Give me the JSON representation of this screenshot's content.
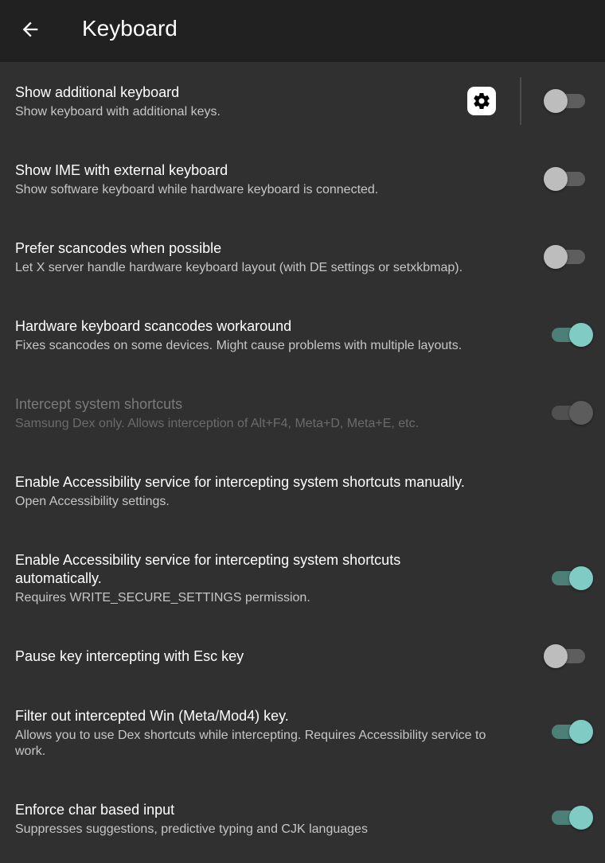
{
  "toolbar": {
    "title": "Keyboard",
    "back_icon": "arrow-back-icon"
  },
  "prefs": [
    {
      "title": "Show additional keyboard",
      "summary": "Show keyboard with additional keys.",
      "state": "off",
      "has_settings_button": true,
      "settings_icon": "gear-icon"
    },
    {
      "title": "Show IME with external keyboard",
      "summary": "Show software keyboard while hardware keyboard is connected.",
      "state": "off"
    },
    {
      "title": "Prefer scancodes when possible",
      "summary": "Let X server handle hardware keyboard layout (with DE settings or setxkbmap).",
      "state": "off"
    },
    {
      "title": "Hardware keyboard scancodes workaround",
      "summary": "Fixes scancodes on some devices. Might cause problems with multiple layouts.",
      "state": "on"
    },
    {
      "title": "Intercept system shortcuts",
      "summary": "Samsung Dex only. Allows interception of Alt+F4, Meta+D, Meta+E, etc.",
      "state": "on",
      "enabled": false
    },
    {
      "title": "Enable Accessibility service for intercepting system shortcuts manually.",
      "summary": "Open Accessibility settings."
    },
    {
      "title_line1": "Enable Accessibility service for intercepting system shortcuts",
      "title_line2": "automatically.",
      "summary": "Requires WRITE_SECURE_SETTINGS permission.",
      "state": "on"
    },
    {
      "title": "Pause key intercepting with Esc key",
      "state": "off"
    },
    {
      "title": "Filter out intercepted Win (Meta/Mod4) key.",
      "summary_line1": "Allows you to use Dex shortcuts while intercepting. Requires Accessibility service to",
      "summary_line2": "work.",
      "state": "on"
    },
    {
      "title": "Enforce char based input",
      "summary": "Suppresses suggestions, predictive typing and CJK languages",
      "state": "on"
    }
  ],
  "colors": {
    "background": "#303030",
    "toolbar": "#212121",
    "accent": "#80cbc4"
  }
}
